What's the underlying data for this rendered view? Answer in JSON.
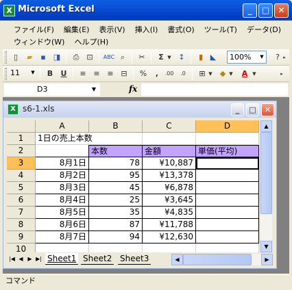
{
  "app": {
    "title": "Microsoft Excel",
    "icon_text": "X"
  },
  "window_controls": {
    "minimize": "_",
    "maximize": "□",
    "close": "✕"
  },
  "menu": {
    "row1": [
      "ファイル(F)",
      "編集(E)",
      "表示(V)",
      "挿入(I)",
      "書式(O)",
      "ツール(T)",
      "データ(D)"
    ],
    "row2": [
      "ウィンドウ(W)",
      "ヘルプ(H)"
    ]
  },
  "toolbar": {
    "zoom": "100%",
    "font_size": "11",
    "bold": "B",
    "underline": "U",
    "percent": "%",
    "comma": ",",
    "sigma": "Σ"
  },
  "formula_bar": {
    "name_box": "D3",
    "fx": "fx",
    "value": ""
  },
  "workbook": {
    "title": "s6-1.xls",
    "icon_text": "X"
  },
  "columns": [
    "A",
    "B",
    "C",
    "D"
  ],
  "rows": [
    "1",
    "2",
    "3",
    "4",
    "5",
    "6",
    "7",
    "8",
    "9",
    "10"
  ],
  "sheet": {
    "title": "1日の売上本数",
    "headers": [
      "",
      "本数",
      "金額",
      "単価(平均)"
    ],
    "data": [
      {
        "date": "8月1日",
        "qty": "78",
        "amount": "¥10,887"
      },
      {
        "date": "8月2日",
        "qty": "95",
        "amount": "¥13,378"
      },
      {
        "date": "8月3日",
        "qty": "45",
        "amount": "¥6,878"
      },
      {
        "date": "8月4日",
        "qty": "25",
        "amount": "¥3,645"
      },
      {
        "date": "8月5日",
        "qty": "35",
        "amount": "¥4,835"
      },
      {
        "date": "8月6日",
        "qty": "87",
        "amount": "¥11,788"
      },
      {
        "date": "8月7日",
        "qty": "94",
        "amount": "¥12,630"
      }
    ]
  },
  "tabs": [
    "Sheet1",
    "Sheet2",
    "Sheet3"
  ],
  "status": "コマンド",
  "colors": {
    "header_fill": "#c2a4ff",
    "selected_header": "#ffc05a",
    "title_bar": "#0a4fd6"
  }
}
